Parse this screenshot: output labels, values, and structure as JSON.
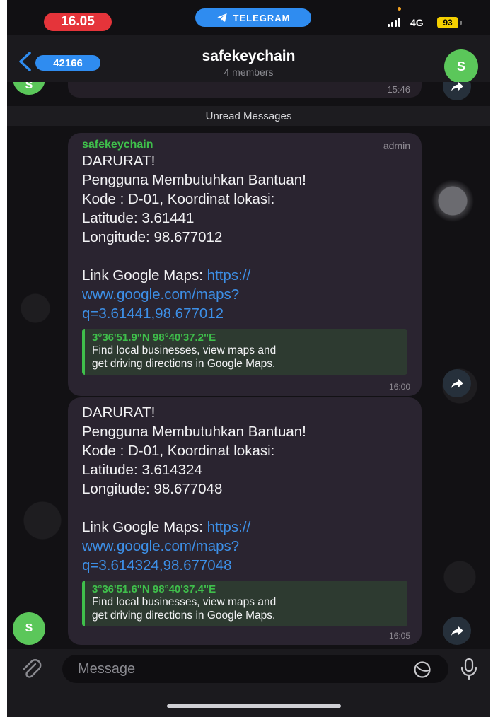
{
  "status_bar": {
    "time": "16.05",
    "app_pill": "TELEGRAM",
    "network": "4G",
    "battery": "93"
  },
  "header": {
    "back_count": "42166",
    "title": "safekeychain",
    "subtitle": "4 members",
    "avatar_letter": "S"
  },
  "chat": {
    "previous_time": "15:46",
    "previous_avatar_letter": "S",
    "unread_label": "Unread Messages",
    "sender_avatar_letter": "S",
    "messages": [
      {
        "sender": "safekeychain",
        "role": "admin",
        "lines": [
          "DARURAT!",
          "Pengguna Membutuhkan Bantuan!",
          "Kode : D-01, Koordinat lokasi:",
          "Latitude: 3.61441",
          "Longitude: 98.677012"
        ],
        "link_prefix": "Link Google Maps: ",
        "link_lines": [
          "https://",
          "www.google.com/maps?",
          "q=3.61441,98.677012"
        ],
        "preview_title": "3°36'51.9\"N 98°40'37.2\"E",
        "preview_desc_lines": [
          "Find local businesses, view maps and",
          "get driving directions in Google Maps."
        ],
        "time": "16:00"
      },
      {
        "lines": [
          "DARURAT!",
          "Pengguna Membutuhkan Bantuan!",
          "Kode : D-01, Koordinat lokasi:",
          "Latitude: 3.614324",
          "Longitude: 98.677048"
        ],
        "link_prefix": "Link Google Maps: ",
        "link_lines": [
          "https://",
          "www.google.com/maps?",
          "q=3.614324,98.677048"
        ],
        "preview_title": "3°36'51.6\"N 98°40'37.4\"E",
        "preview_desc_lines": [
          "Find local businesses, view maps and",
          "get driving directions in Google Maps."
        ],
        "time": "16:05"
      }
    ]
  },
  "input_bar": {
    "placeholder": "Message"
  },
  "colors": {
    "accent_blue": "#2f8cf0",
    "time_pill_red": "#e5343a",
    "sender_green": "#3fbf4b",
    "link_blue": "#3d8fe6",
    "bubble_bg": "#2a2430"
  }
}
